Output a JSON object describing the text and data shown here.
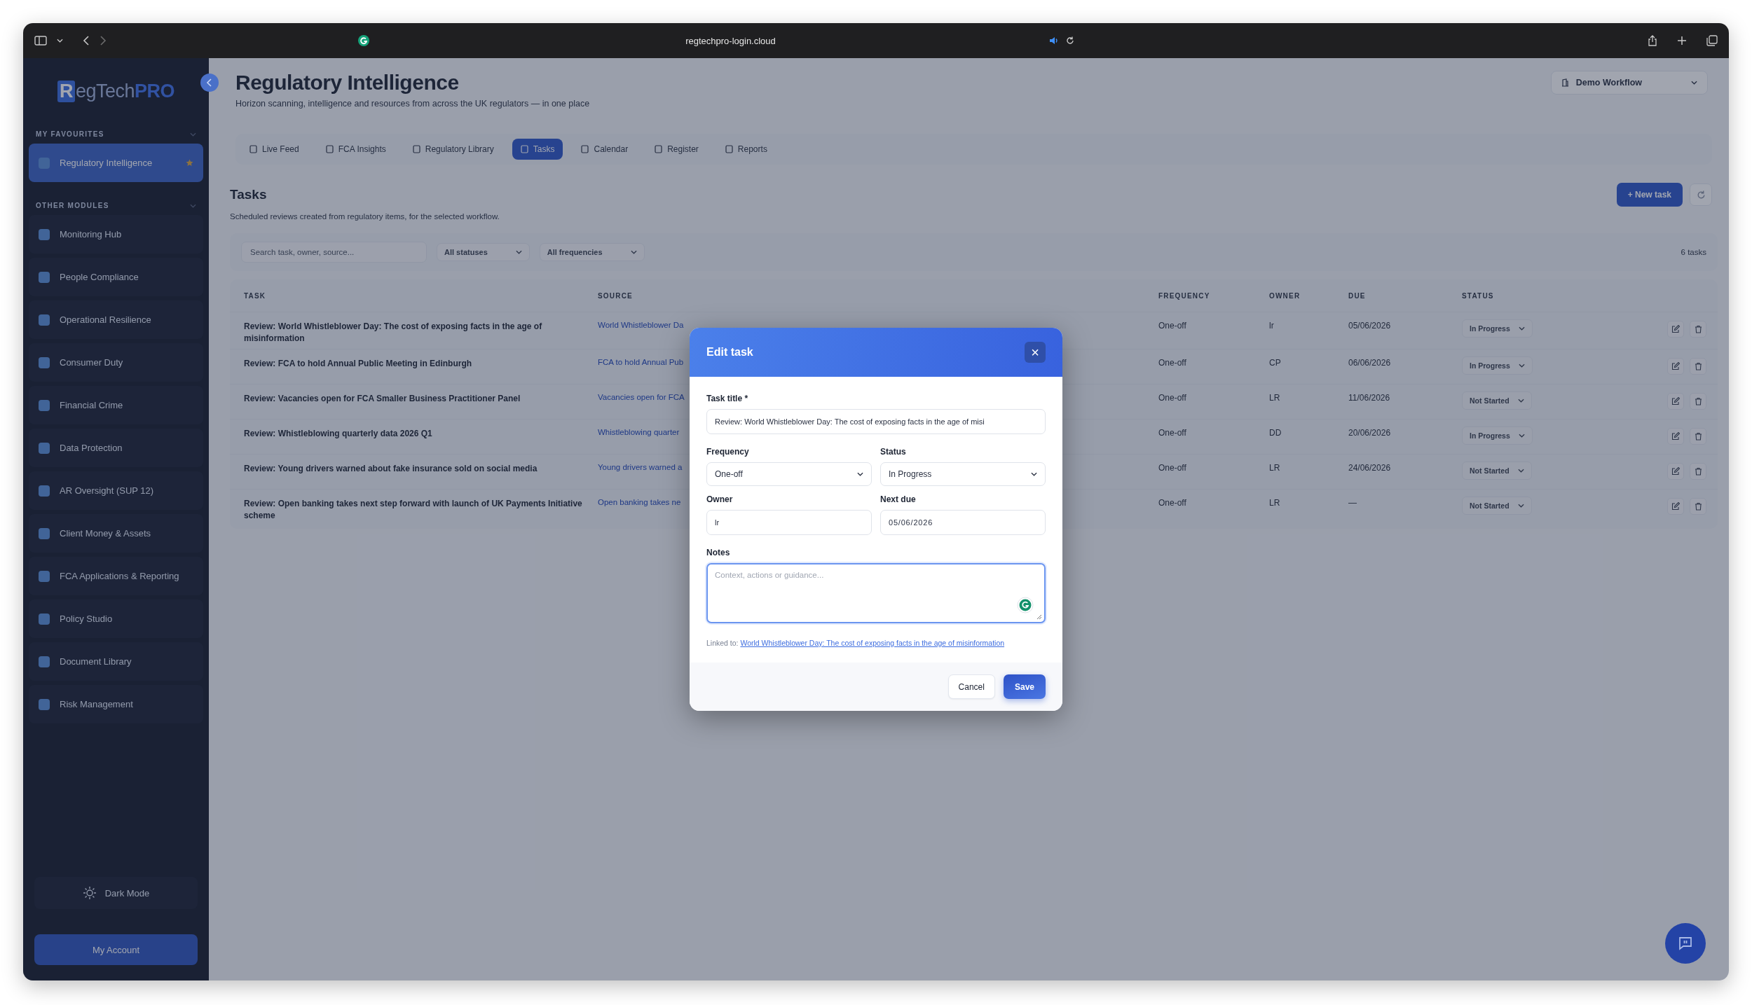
{
  "browser": {
    "url": "regtechpro-login.cloud"
  },
  "sidebar": {
    "logo": {
      "box_letter": "R",
      "text": "egTech",
      "accent": "PRO"
    },
    "favourites_label": "MY FAVOURITES",
    "favourites": [
      {
        "label": "Regulatory Intelligence",
        "selected": true
      }
    ],
    "modules_label": "OTHER MODULES",
    "modules": [
      {
        "label": "Monitoring Hub",
        "selected": false
      },
      {
        "label": "People Compliance",
        "selected": false
      },
      {
        "label": "Operational Resilience",
        "selected": false
      },
      {
        "label": "Consumer Duty",
        "selected": false
      },
      {
        "label": "Financial Crime",
        "selected": false
      },
      {
        "label": "Data Protection",
        "selected": false
      },
      {
        "label": "AR Oversight (SUP 12)",
        "selected": false
      },
      {
        "label": "Client Money & Assets",
        "selected": false
      },
      {
        "label": "FCA Applications & Reporting",
        "selected": false
      },
      {
        "label": "Policy Studio",
        "selected": false
      },
      {
        "label": "Document Library",
        "selected": false
      },
      {
        "label": "Risk Management",
        "selected": false
      }
    ],
    "dark_mode": "Dark Mode",
    "account": "My Account"
  },
  "header": {
    "title": "Regulatory Intelligence",
    "subtitle": "Horizon scanning, intelligence and resources from across the UK regulators — in one place",
    "workflow": "Demo Workflow"
  },
  "tabs": [
    {
      "label": "Live Feed",
      "selected": false
    },
    {
      "label": "FCA Insights",
      "selected": false
    },
    {
      "label": "Regulatory Library",
      "selected": false
    },
    {
      "label": "Tasks",
      "selected": true
    },
    {
      "label": "Calendar",
      "selected": false
    },
    {
      "label": "Register",
      "selected": false
    },
    {
      "label": "Reports",
      "selected": false
    }
  ],
  "tasks": {
    "title": "Tasks",
    "subtitle": "Scheduled reviews created from regulatory items, for the selected workflow.",
    "new_button": "+ New task",
    "search": {
      "placeholder": "Search task, owner, source..."
    },
    "status_filter": "All statuses",
    "frequency_filter": "All frequencies",
    "count": "6 tasks",
    "columns": [
      "TASK",
      "SOURCE",
      "FREQUENCY",
      "OWNER",
      "DUE",
      "STATUS"
    ],
    "rows": [
      {
        "task": "Review: World Whistleblower Day: The cost of exposing facts in the age of misinformation",
        "source": "World Whistleblower Da",
        "frequency": "One-off",
        "owner": "lr",
        "due": "05/06/2026",
        "status": "In Progress"
      },
      {
        "task": "Review: FCA to hold Annual Public Meeting in Edinburgh",
        "source": "FCA to hold Annual Pub",
        "frequency": "One-off",
        "owner": "CP",
        "due": "06/06/2026",
        "status": "In Progress"
      },
      {
        "task": "Review: Vacancies open for FCA Smaller Business Practitioner Panel",
        "source": "Vacancies open for FCA",
        "frequency": "One-off",
        "owner": "LR",
        "due": "11/06/2026",
        "status": "Not Started"
      },
      {
        "task": "Review: Whistleblowing quarterly data 2026 Q1",
        "source": "Whistleblowing quarter",
        "frequency": "One-off",
        "owner": "DD",
        "due": "20/06/2026",
        "status": "In Progress"
      },
      {
        "task": "Review: Young drivers warned about fake insurance sold on social media",
        "source": "Young drivers warned a",
        "frequency": "One-off",
        "owner": "LR",
        "due": "24/06/2026",
        "status": "Not Started"
      },
      {
        "task": "Review: Open banking takes next step forward with launch of UK Payments Initiative scheme",
        "source": "Open banking takes ne",
        "frequency": "One-off",
        "owner": "LR",
        "due": "—",
        "status": "Not Started"
      }
    ]
  },
  "modal": {
    "title": "Edit task",
    "close": "×",
    "task_title": {
      "label": "Task title *",
      "value": "Review: World Whistleblower Day: The cost of exposing facts in the age of misi"
    },
    "frequency": {
      "label": "Frequency",
      "value": "One-off"
    },
    "status": {
      "label": "Status",
      "value": "In Progress"
    },
    "owner": {
      "label": "Owner",
      "value": "lr"
    },
    "next_due": {
      "label": "Next due",
      "value": "05/06/2026"
    },
    "notes": {
      "label": "Notes",
      "placeholder": "Context, actions or guidance..."
    },
    "linked_label": "Linked to: ",
    "linked_link": "World Whistleblower Day: The cost of exposing facts in the age of misinformation",
    "cancel": "Cancel",
    "save": "Save"
  }
}
